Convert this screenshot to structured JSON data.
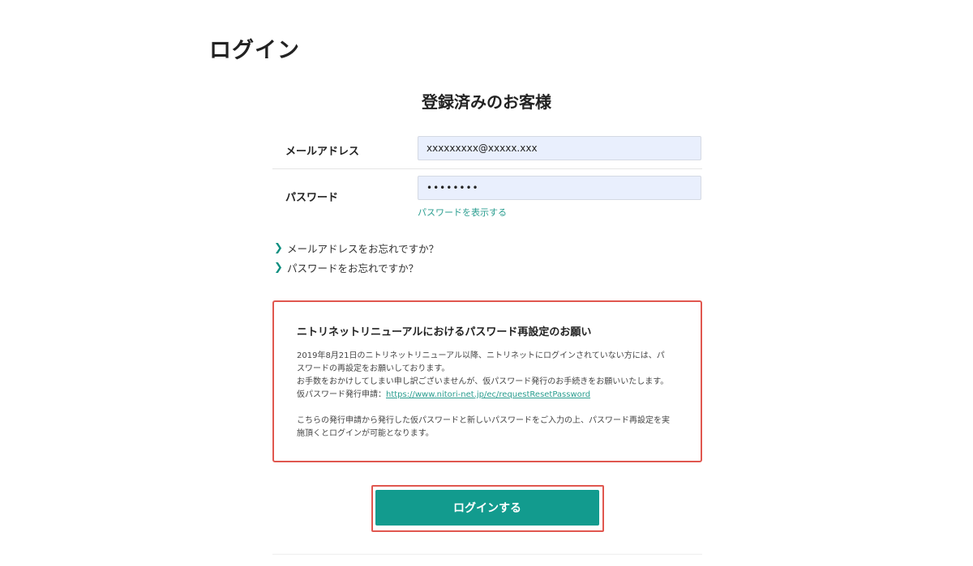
{
  "page": {
    "title": "ログイン"
  },
  "section": {
    "title": "登録済みのお客様"
  },
  "form": {
    "email": {
      "label": "メールアドレス",
      "value": "xxxxxxxxx@xxxxx.xxx"
    },
    "password": {
      "label": "パスワード",
      "value": "••••••••",
      "show_link": "パスワードを表示する"
    }
  },
  "help_links": [
    {
      "label": "メールアドレスをお忘れですか？",
      "icon": "chevron-right-icon"
    },
    {
      "label": "パスワードをお忘れですか？",
      "icon": "chevron-right-icon"
    }
  ],
  "notice": {
    "title": "ニトリネットリニューアルにおけるパスワード再設定のお願い",
    "line1": "2019年8月21日のニトリネットリニューアル以降、ニトリネットにログインされていない方には、パ",
    "line2": "スワードの再設定をお願いしております。",
    "line3": "お手数をおかけしてしまい申し訳ございませんが、仮パスワード発行のお手続きをお願いいたします。",
    "link_prefix": "仮パスワード発行申請：",
    "link_text": "https://www.nitori-net.jp/ec/requestResetPassword",
    "line4": "こちらの発行申請から発行した仮パスワードと新しいパスワードをご入力の上、パスワード再設定を実",
    "line5": "施頂くとログインが可能となります。"
  },
  "login_button": {
    "label": "ログインする"
  },
  "colors": {
    "accent": "#129b8e",
    "link": "#2a9d8f",
    "highlight_border": "#e0574f",
    "input_bg": "#e9effd"
  }
}
